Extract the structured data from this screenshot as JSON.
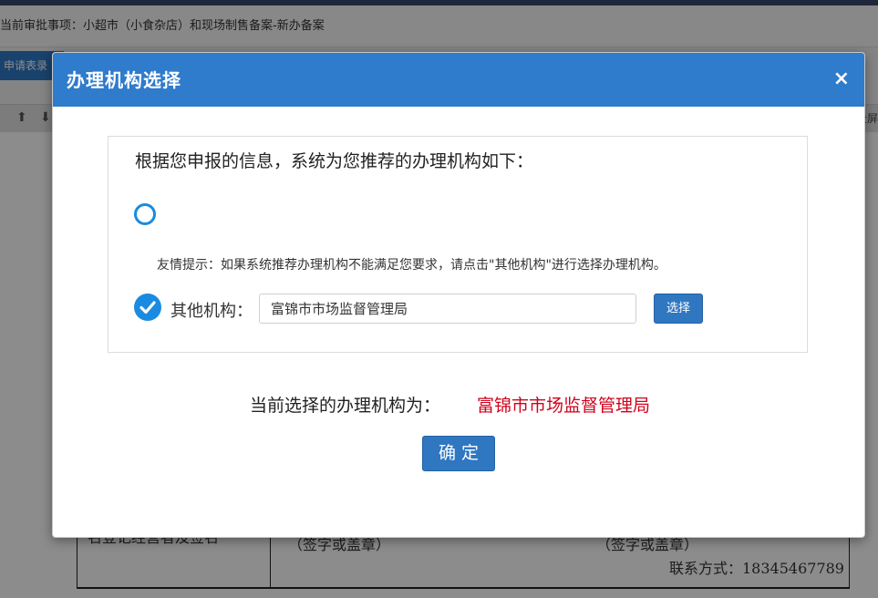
{
  "background": {
    "header_text": "当前审批事项：小超市（小食杂店）和现场制售备案-新办备案",
    "tab_label": "申请表录",
    "toolbar_right": "全屏",
    "table_left_text": "名登记经营者及签名",
    "sign_left": "（签字或盖章）",
    "sign_right": "（签字或盖章）",
    "contact": "联系方式：18345467789"
  },
  "modal": {
    "title": "办理机构选择",
    "close_symbol": "×",
    "intro_text": "根据您申报的信息，系统为您推荐的办理机构如下：",
    "tip_text": "友情提示：如果系统推荐办理机构不能满足您要求，请点击\"其他机构\"进行选择办理机构。",
    "other_label": "其他机构：",
    "other_value": "富锦市市场监督管理局",
    "choose_button": "选择",
    "current_label": "当前选择的办理机构为：",
    "current_value": "富锦市市场监督管理局",
    "confirm_button": "确定"
  },
  "colors": {
    "header_blue": "#2f7bcc",
    "button_blue": "#2f77c1",
    "radio_blue": "#1a8be0",
    "highlight_red": "#d0021b"
  },
  "icons": {
    "radio_recommended": "radio-unchecked-icon",
    "radio_other": "check-circle-icon",
    "close": "close-icon",
    "toolbar": [
      "arrow-up-icon",
      "arrow-down-icon"
    ]
  }
}
